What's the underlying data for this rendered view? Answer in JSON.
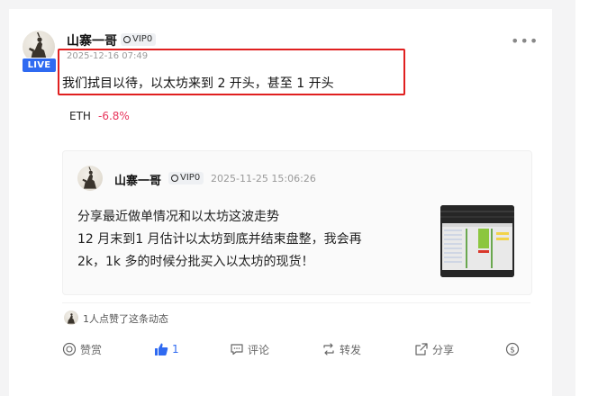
{
  "post": {
    "author": "山寨一哥",
    "vip_label": "VIP0",
    "live_badge": "LIVE",
    "time": "2025-12-16 07:49",
    "text": "我们拭目以待，以太坊来到 2 开头，甚至 1 开头",
    "coin": {
      "symbol": "ETH",
      "change": "-6.8%"
    }
  },
  "quoted_post": {
    "author": "山寨一哥",
    "vip_label": "VIP0",
    "time": "2025-11-25 15:06:26",
    "lines": [
      "分享最近做单情况和以太坊这波走势",
      "12 月末到1 月估计以太坊到底并结束盘整，我会再",
      "2k，1k 多的时候分批买入以太坊的现货！"
    ]
  },
  "likes_summary": "1人点赞了这条动态",
  "actions": {
    "tip": "赞赏",
    "like_count": "1",
    "comment": "评论",
    "repost": "转发",
    "share": "分享"
  },
  "colors": {
    "accent_blue": "#2f6af1",
    "negative_red": "#e8355c",
    "highlight_border": "#e02020"
  },
  "icons": [
    "more-icon",
    "tip-icon",
    "like-icon",
    "comment-icon",
    "repost-icon",
    "share-icon",
    "dollar-icon"
  ]
}
